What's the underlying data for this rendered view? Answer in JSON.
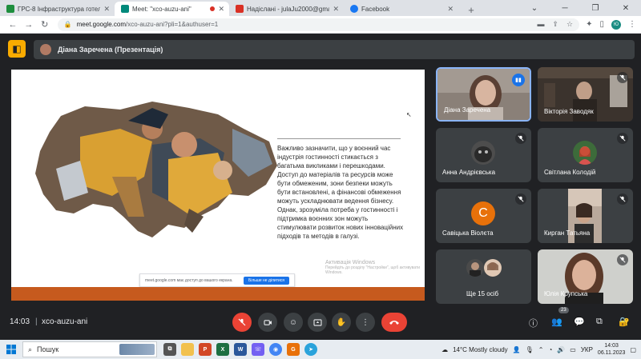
{
  "browser": {
    "tabs": [
      {
        "label": "ГРС-8 Інфраструктура готельн",
        "color": "#1e8e3e",
        "active": false
      },
      {
        "label": "Meet: \"xco-auzu-ani\"",
        "color": "#00897b",
        "active": true
      },
      {
        "label": "Надіслані - julaJu2000@gmail.c",
        "color": "#d93025",
        "active": false
      },
      {
        "label": "Facebook",
        "color": "#1877f2",
        "active": false
      }
    ],
    "url_host": "meet.google.com",
    "url_path": "/xco-auzu-ani?pli=1&authuser=1",
    "profile_initials": "Ю"
  },
  "meet": {
    "presenter_title": "Діана Заречена (Презентація)"
  },
  "slide": {
    "text": "Важливо зазначити, що у воєнний час індустрія гостинності стикається з багатьма викликами і перешкодами. Доступ до матеріалів та ресурсів може бути обмеженим, зони безпеки можуть бути встановлені, а фінансові обмеження можуть ускладнювати ведення бізнесу. Однак, зрозуміла потреба у гостинності і підтримка воєнних зон можуть стимулювати розвиток нових інноваційних підходів та методів в галузі.",
    "activation_title": "Активація Windows",
    "activation_sub": "Перейдіть до розділу \"Настройки\", щоб активувати Windows.",
    "share_text": "meet.google.com має доступ до вашого екрана.",
    "share_button": "Більше не ділитися"
  },
  "participants": [
    {
      "name": "Діана Заречена",
      "speaking": true
    },
    {
      "name": "Вікторія Заводяк",
      "muted": true
    },
    {
      "name": "Анна Андрієвська",
      "muted": true
    },
    {
      "name": "Світлана Колодій",
      "muted": true
    },
    {
      "name": "Савіцька Віолєта",
      "muted": true,
      "initial": "С"
    },
    {
      "name": "Кирган Татьяна",
      "muted": true
    },
    {
      "name": "Ще 15 осіб"
    },
    {
      "name": "Юлія Крупська",
      "muted": true
    }
  ],
  "bottom": {
    "time": "14:03",
    "separator": "|",
    "meeting_code": "xco-auzu-ani",
    "people_count": "23"
  },
  "taskbar": {
    "search": "Пошук",
    "weather": "14°C  Mostly cloudy",
    "lang": "УКР",
    "time": "14:03",
    "date": "06.11.2023"
  },
  "colors": {
    "meet_bg": "#202124",
    "tile_bg": "#3c4043",
    "hangup": "#ea4335",
    "speaking_outline": "#8ab4f8",
    "slide_band": "#c65a1e"
  }
}
